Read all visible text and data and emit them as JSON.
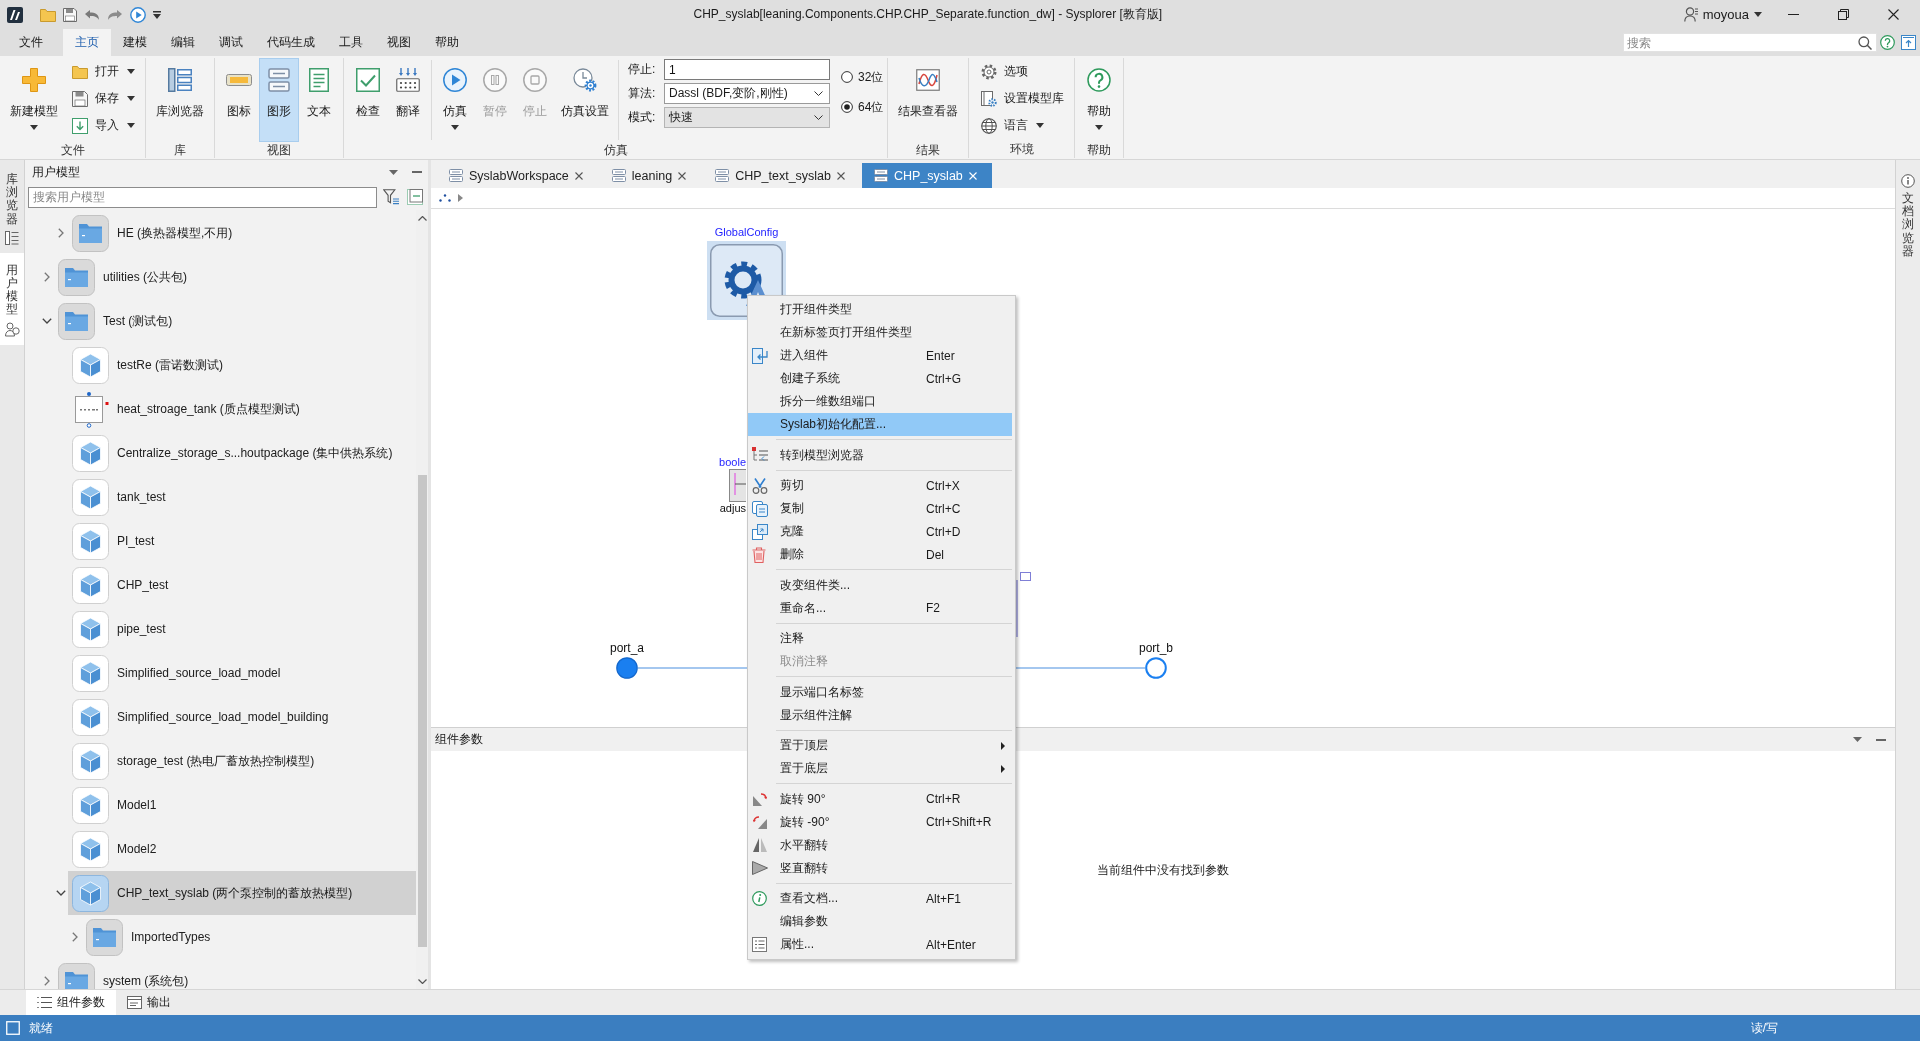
{
  "window": {
    "title": "CHP_syslab[leaning.Components.CHP.CHP_Separate.function_dw] - Sysplorer [教育版]",
    "user": "moyoua"
  },
  "menu_bar": {
    "items": [
      {
        "label": "文件",
        "selected": false
      },
      {
        "label": "主页",
        "selected": true
      },
      {
        "label": "建模",
        "selected": false
      },
      {
        "label": "编辑",
        "selected": false
      },
      {
        "label": "调试",
        "selected": false
      },
      {
        "label": "代码生成",
        "selected": false
      },
      {
        "label": "工具",
        "selected": false
      },
      {
        "label": "视图",
        "selected": false
      },
      {
        "label": "帮助",
        "selected": false
      }
    ],
    "search": {
      "placeholder": "搜索"
    }
  },
  "ribbon": {
    "groups": [
      {
        "label": "文件",
        "sections": [
          [
            {
              "kind": "large",
              "label": "新建模型",
              "dropdown": true,
              "disabled": false
            },
            {
              "kind": "small",
              "label": "打开",
              "dropdown": true,
              "disabled": false
            },
            {
              "kind": "small",
              "label": "保存",
              "dropdown": true,
              "disabled": false
            },
            {
              "kind": "small",
              "label": "导入",
              "dropdown": true,
              "disabled": false
            }
          ]
        ]
      },
      {
        "label": "库",
        "sections": [
          [
            {
              "kind": "large",
              "label": "库浏览器",
              "dropdown": false,
              "disabled": false
            }
          ]
        ]
      },
      {
        "label": "视图",
        "sections": [
          [
            {
              "kind": "large",
              "label": "图标",
              "dropdown": false,
              "disabled": false,
              "selected": false
            },
            {
              "kind": "large",
              "label": "图形",
              "dropdown": false,
              "disabled": false,
              "selected": true
            },
            {
              "kind": "large",
              "label": "文本",
              "dropdown": false,
              "disabled": false,
              "selected": false
            }
          ]
        ]
      },
      {
        "label": "仿真",
        "sections": [
          [
            {
              "kind": "large",
              "label": "检查",
              "dropdown": false,
              "disabled": false
            },
            {
              "kind": "large",
              "label": "翻译",
              "dropdown": false,
              "disabled": false
            }
          ],
          [
            {
              "kind": "large",
              "label": "仿真",
              "dropdown": true,
              "disabled": false
            },
            {
              "kind": "large",
              "label": "暂停",
              "dropdown": false,
              "disabled": true
            },
            {
              "kind": "large",
              "label": "停止",
              "dropdown": false,
              "disabled": true
            },
            {
              "kind": "large",
              "label": "仿真设置",
              "dropdown": false,
              "disabled": false
            }
          ],
          [
            {
              "kind": "field",
              "label": "停止:",
              "value": "1"
            },
            {
              "kind": "combo",
              "label": "算法:",
              "value": "Dassl (BDF,变阶,刚性)",
              "disabled": false
            },
            {
              "kind": "combo",
              "label": "模式:",
              "value": "快速",
              "disabled": true
            },
            {
              "kind": "radio",
              "label": "32位",
              "selected": false
            },
            {
              "kind": "radio",
              "label": "64位",
              "selected": true
            }
          ]
        ]
      },
      {
        "label": "结果",
        "sections": [
          [
            {
              "kind": "large",
              "label": "结果查看器",
              "dropdown": false,
              "disabled": false
            }
          ]
        ]
      },
      {
        "label": "环境",
        "sections": [
          [
            {
              "kind": "small",
              "label": "选项",
              "dropdown": false,
              "disabled": false
            },
            {
              "kind": "small",
              "label": "设置模型库",
              "dropdown": false,
              "disabled": false
            },
            {
              "kind": "small",
              "label": "语言",
              "dropdown": true,
              "disabled": false
            }
          ]
        ]
      },
      {
        "label": "帮助",
        "sections": [
          [
            {
              "kind": "large",
              "label": "帮助",
              "dropdown": true,
              "disabled": false
            }
          ]
        ]
      }
    ]
  },
  "side_tabs": [
    {
      "label": "库浏览器",
      "selected": false
    },
    {
      "label": "用户模型",
      "selected": true
    }
  ],
  "left_panel": {
    "title": "用户模型",
    "search": {
      "placeholder": "搜索用户模型"
    },
    "tree": {
      "continued_children": [
        {
          "label": "HE (换热器模型,不用)",
          "kind": "package",
          "expanded": false,
          "selected": false
        }
      ],
      "items": [
        {
          "label": "utilities (公共包)",
          "kind": "package",
          "expanded": false,
          "selected": false
        },
        {
          "label": "Test (测试包)",
          "kind": "package",
          "expanded": true,
          "selected": false,
          "children": [
            {
              "label": "testRe (雷诺数测试)",
              "kind": "model",
              "selected": false
            },
            {
              "label": "heat_stroage_tank (质点模型测试)",
              "kind": "block",
              "selected": false
            },
            {
              "label": "Centralize_storage_s...houtpackage (集中供热系统)",
              "kind": "model",
              "selected": false
            },
            {
              "label": "tank_test",
              "kind": "model",
              "selected": false
            },
            {
              "label": "PI_test",
              "kind": "model",
              "selected": false
            },
            {
              "label": "CHP_test",
              "kind": "model",
              "selected": false
            },
            {
              "label": "pipe_test",
              "kind": "model",
              "selected": false
            },
            {
              "label": "Simplified_source_load_model",
              "kind": "model",
              "selected": false
            },
            {
              "label": "Simplified_source_load_model_building",
              "kind": "model",
              "selected": false
            },
            {
              "label": "storage_test (热电厂蓄放热控制模型)",
              "kind": "model",
              "selected": false
            },
            {
              "label": "Model1",
              "kind": "model",
              "selected": false
            },
            {
              "label": "Model2",
              "kind": "model",
              "selected": false
            },
            {
              "label": "CHP_text_syslab (两个泵控制的蓄放热模型)",
              "kind": "model",
              "expanded": true,
              "selected": true,
              "children": [
                {
                  "label": "ImportedTypes",
                  "kind": "package",
                  "expanded": false,
                  "selected": false
                }
              ]
            }
          ]
        },
        {
          "label": "system (系统包)",
          "kind": "package",
          "expanded": false,
          "selected": false
        }
      ]
    }
  },
  "editor_tabs": [
    {
      "label": "SyslabWorkspace",
      "selected": false
    },
    {
      "label": "leaning",
      "selected": false
    },
    {
      "label": "CHP_text_syslab",
      "selected": false
    },
    {
      "label": "CHP_syslab",
      "selected": true
    }
  ],
  "canvas": {
    "components": [
      {
        "kind": "config",
        "label": "GlobalConfig",
        "selected": true
      },
      {
        "kind": "chart_block",
        "label": "boole",
        "caption": "adjus",
        "selected": false
      }
    ],
    "ports": [
      {
        "kind": "filled",
        "label": "port_a"
      },
      {
        "kind": "hollow",
        "label": "port_b"
      }
    ]
  },
  "parameters_panel": {
    "title": "组件参数",
    "message": "当前组件中没有找到参数"
  },
  "context_menu": {
    "sections": [
      [
        {
          "label": "打开组件类型",
          "highlighted": false,
          "disabled": false,
          "submenu": false
        },
        {
          "label": "在新标签页打开组件类型",
          "highlighted": false,
          "disabled": false,
          "submenu": false
        },
        {
          "label": "进入组件",
          "shortcut": "Enter",
          "highlighted": false,
          "disabled": false,
          "submenu": false
        },
        {
          "label": "创建子系统",
          "shortcut": "Ctrl+G",
          "highlighted": false,
          "disabled": false,
          "submenu": false
        },
        {
          "label": "拆分一维数组端口",
          "highlighted": false,
          "disabled": false,
          "submenu": false
        },
        {
          "label": "Syslab初始化配置...",
          "highlighted": true,
          "disabled": false,
          "submenu": false
        }
      ],
      [
        {
          "label": "转到模型浏览器",
          "highlighted": false,
          "disabled": false,
          "submenu": false
        }
      ],
      [
        {
          "label": "剪切",
          "shortcut": "Ctrl+X",
          "highlighted": false,
          "disabled": false,
          "submenu": false
        },
        {
          "label": "复制",
          "shortcut": "Ctrl+C",
          "highlighted": false,
          "disabled": false,
          "submenu": false
        },
        {
          "label": "克隆",
          "shortcut": "Ctrl+D",
          "highlighted": false,
          "disabled": false,
          "submenu": false
        },
        {
          "label": "删除",
          "shortcut": "Del",
          "highlighted": false,
          "disabled": false,
          "submenu": false
        }
      ],
      [
        {
          "label": "改变组件类...",
          "highlighted": false,
          "disabled": false,
          "submenu": false
        },
        {
          "label": "重命名...",
          "shortcut": "F2",
          "highlighted": false,
          "disabled": false,
          "submenu": false
        }
      ],
      [
        {
          "label": "注释",
          "highlighted": false,
          "disabled": false,
          "submenu": false
        },
        {
          "label": "取消注释",
          "highlighted": false,
          "disabled": true,
          "submenu": false
        }
      ],
      [
        {
          "label": "显示端口名标签",
          "highlighted": false,
          "disabled": false,
          "submenu": false
        },
        {
          "label": "显示组件注解",
          "highlighted": false,
          "disabled": false,
          "submenu": false
        }
      ],
      [
        {
          "label": "置于顶层",
          "highlighted": false,
          "disabled": false,
          "submenu": true
        },
        {
          "label": "置于底层",
          "highlighted": false,
          "disabled": false,
          "submenu": true
        }
      ],
      [
        {
          "label": "旋转 90°",
          "shortcut": "Ctrl+R",
          "highlighted": false,
          "disabled": false,
          "submenu": false
        },
        {
          "label": "旋转 -90°",
          "shortcut": "Ctrl+Shift+R",
          "highlighted": false,
          "disabled": false,
          "submenu": false
        },
        {
          "label": "水平翻转",
          "highlighted": false,
          "disabled": false,
          "submenu": false
        },
        {
          "label": "竖直翻转",
          "highlighted": false,
          "disabled": false,
          "submenu": false
        }
      ],
      [
        {
          "label": "查看文档...",
          "shortcut": "Alt+F1",
          "highlighted": false,
          "disabled": false,
          "submenu": false
        },
        {
          "label": "编辑参数",
          "highlighted": false,
          "disabled": false,
          "submenu": false
        },
        {
          "label": "属性...",
          "shortcut": "Alt+Enter",
          "highlighted": false,
          "disabled": false,
          "submenu": false
        }
      ]
    ]
  },
  "document_browser_tab": {
    "label": "文档浏览器"
  },
  "bottom_tabs": [
    {
      "label": "组件参数",
      "selected": true
    },
    {
      "label": "输出",
      "selected": false
    }
  ],
  "status_bar": {
    "status": "就绪",
    "mode": "读/写"
  }
}
